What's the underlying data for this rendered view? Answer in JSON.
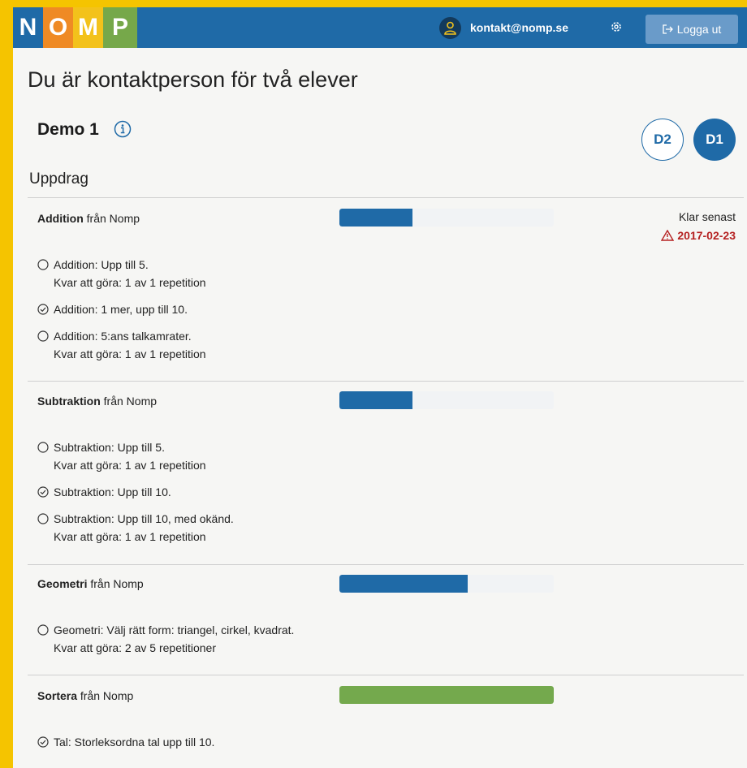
{
  "header": {
    "logo_letters": [
      "N",
      "O",
      "M",
      "P"
    ],
    "user_email": "kontakt@nomp.se",
    "logout_label": "Logga ut",
    "icons": {
      "user": "user-icon",
      "settings": "gear-icon",
      "logout": "logout-icon"
    }
  },
  "page": {
    "title": "Du är kontaktperson för två elever",
    "student_name": "Demo 1",
    "student_avatars": [
      "D2",
      "D1"
    ],
    "section_title": "Uppdrag"
  },
  "deadline": {
    "label": "Klar senast",
    "date": "2017-02-23"
  },
  "colors": {
    "bar_blue": "#1f6aa7",
    "bar_green": "#74a94d",
    "warning_red": "#b52121"
  },
  "assignments": [
    {
      "name": "Addition",
      "source": " från Nomp",
      "progress": 0.34,
      "tasks": [
        {
          "status": "open",
          "text": "Addition: Upp till 5.",
          "remaining": "Kvar att göra: 1 av 1 repetition"
        },
        {
          "status": "done",
          "text": "Addition: 1 mer, upp till 10.",
          "remaining": ""
        },
        {
          "status": "open",
          "text": "Addition: 5:ans talkamrater.",
          "remaining": "Kvar att göra: 1 av 1 repetition"
        }
      ]
    },
    {
      "name": "Subtraktion",
      "source": " från Nomp",
      "progress": 0.34,
      "tasks": [
        {
          "status": "open",
          "text": "Subtraktion: Upp till 5.",
          "remaining": "Kvar att göra: 1 av 1 repetition"
        },
        {
          "status": "done",
          "text": "Subtraktion: Upp till 10.",
          "remaining": ""
        },
        {
          "status": "open",
          "text": "Subtraktion: Upp till 10, med okänd.",
          "remaining": "Kvar att göra: 1 av 1 repetition"
        }
      ]
    },
    {
      "name": "Geometri",
      "source": " från Nomp",
      "progress": 0.6,
      "tasks": [
        {
          "status": "open",
          "text": "Geometri: Välj rätt form: triangel, cirkel, kvadrat.",
          "remaining": "Kvar att göra: 2 av 5 repetitioner"
        }
      ]
    },
    {
      "name": "Sortera",
      "source": " från Nomp",
      "progress": 1.0,
      "tasks": [
        {
          "status": "done",
          "text": "Tal: Storleksordna tal upp till 10.",
          "remaining": ""
        }
      ]
    }
  ]
}
